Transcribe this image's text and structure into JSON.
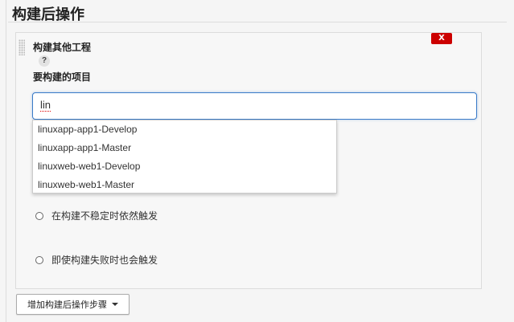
{
  "section": {
    "title": "构建后操作"
  },
  "step": {
    "title": "构建其他工程",
    "delete_label": "X",
    "help_label": "?",
    "field_label": "要构建的项目",
    "input_value": "lin",
    "suggestions": [
      "linuxapp-app1-Develop",
      "linuxapp-app1-Master",
      "linuxweb-web1-Develop",
      "linuxweb-web1-Master"
    ],
    "options": [
      "在构建不稳定时依然触发",
      "即使构建失败时也会触发"
    ]
  },
  "footer": {
    "add_step_label": "增加构建后操作步骤"
  },
  "colors": {
    "accent": "#3a7bc8",
    "danger": "#cc0000"
  }
}
